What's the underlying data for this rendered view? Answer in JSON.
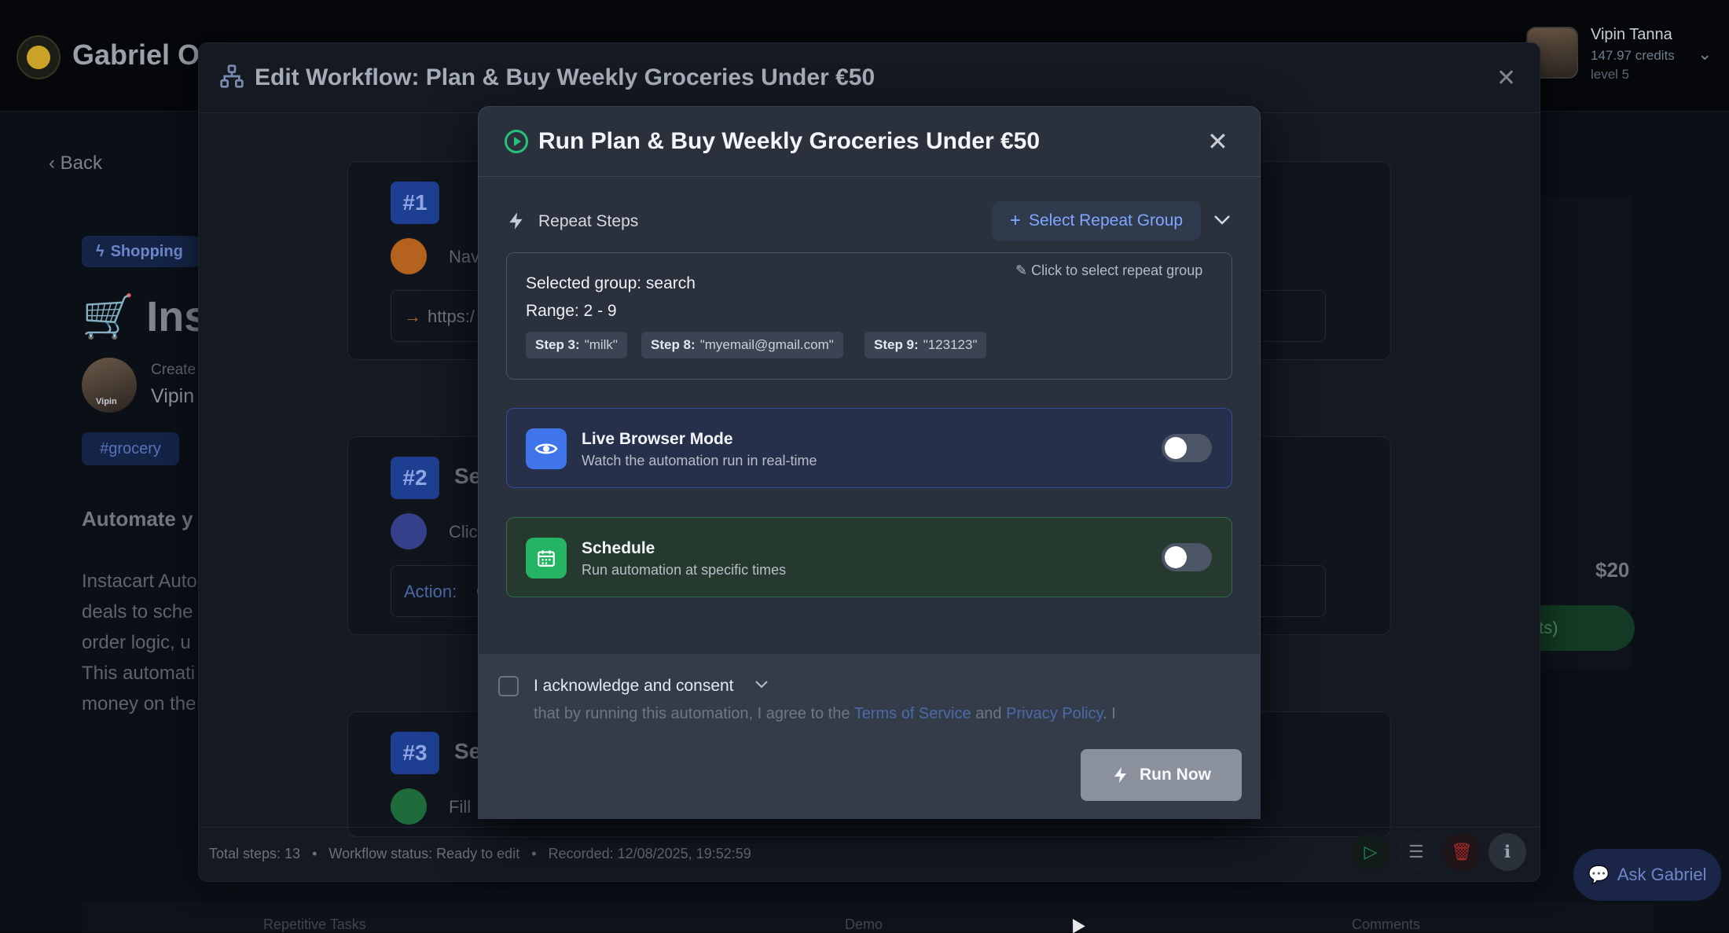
{
  "app": {
    "brand": "Gabriel Op",
    "user": {
      "name": "Vipin Tanna",
      "credits": "147.97 credits",
      "level": "level 5"
    }
  },
  "background": {
    "back_label": "Back",
    "category": "Shopping",
    "title": "Inst",
    "creator_label": "Create",
    "creator_name": "Vipin",
    "avatar_caption": "Vipin",
    "tag": "#grocery",
    "description_heading": "Automate y",
    "description_lines": [
      "Instacart Auto",
      "deals to sche",
      "order logic, u",
      "This automati",
      "money on the"
    ],
    "price": "$20",
    "green_button_label": "ts)",
    "ask_button_label": "Ask Gabriel",
    "bottom_tabs": [
      "Repetitive Tasks",
      "Demo",
      "Comments"
    ]
  },
  "edit_workflow": {
    "title": "Edit Workflow: Plan & Buy Weekly Groceries Under €50",
    "steps": [
      {
        "number": "#1",
        "action": "Nav",
        "detail": "https:/"
      },
      {
        "number": "#2",
        "name": "Se",
        "action": "Clic",
        "detail_label": "Action:",
        "detail_value": "C"
      },
      {
        "number": "#3",
        "name": "Se",
        "action": "Fill"
      }
    ],
    "footer": {
      "total_steps": "Total steps: 13",
      "status": "Workflow status: Ready to edit",
      "recorded": "Recorded: 12/08/2025, 19:52:59",
      "separator": "•"
    }
  },
  "run_modal": {
    "title": "Run Plan & Buy Weekly Groceries Under €50",
    "repeat_steps_label": "Repeat Steps",
    "select_repeat_group_label": "Select Repeat Group",
    "click_to_select_label": "Click to select repeat group",
    "selected_group": "Selected group: search",
    "range": "Range: 2 - 9",
    "chips": [
      {
        "step": "Step 3:",
        "value": "\"milk\""
      },
      {
        "step": "Step 8:",
        "value": "\"myemail@gmail.com\""
      },
      {
        "step": "Step 9:",
        "value": "\"123123\""
      }
    ],
    "live_browser": {
      "title": "Live Browser Mode",
      "subtitle": "Watch the automation run in real-time",
      "enabled": false
    },
    "schedule": {
      "title": "Schedule",
      "subtitle": "Run automation at specific times",
      "enabled": false
    },
    "consent": {
      "label": "I acknowledge and consent",
      "text_prefix": "that by running this automation, I agree to the",
      "terms_link": "Terms of Service",
      "and": "and",
      "privacy_link": "Privacy Policy",
      "text_suffix": "I"
    },
    "run_now_label": "Run Now"
  },
  "icons": {
    "workflow": "workflow-icon",
    "run": "play-circle-icon",
    "bolt": "bolt-icon",
    "eye": "eye-icon",
    "calendar": "calendar-icon",
    "pencil": "pencil-icon",
    "close": "close-icon",
    "chevron": "chevron-down-icon"
  },
  "colors": {
    "accent_blue": "#3f74ea",
    "accent_green": "#25b463",
    "run_icon_green": "#27c27a",
    "link_blue": "#7fa7ff",
    "modal_bg": "#2a313d"
  }
}
